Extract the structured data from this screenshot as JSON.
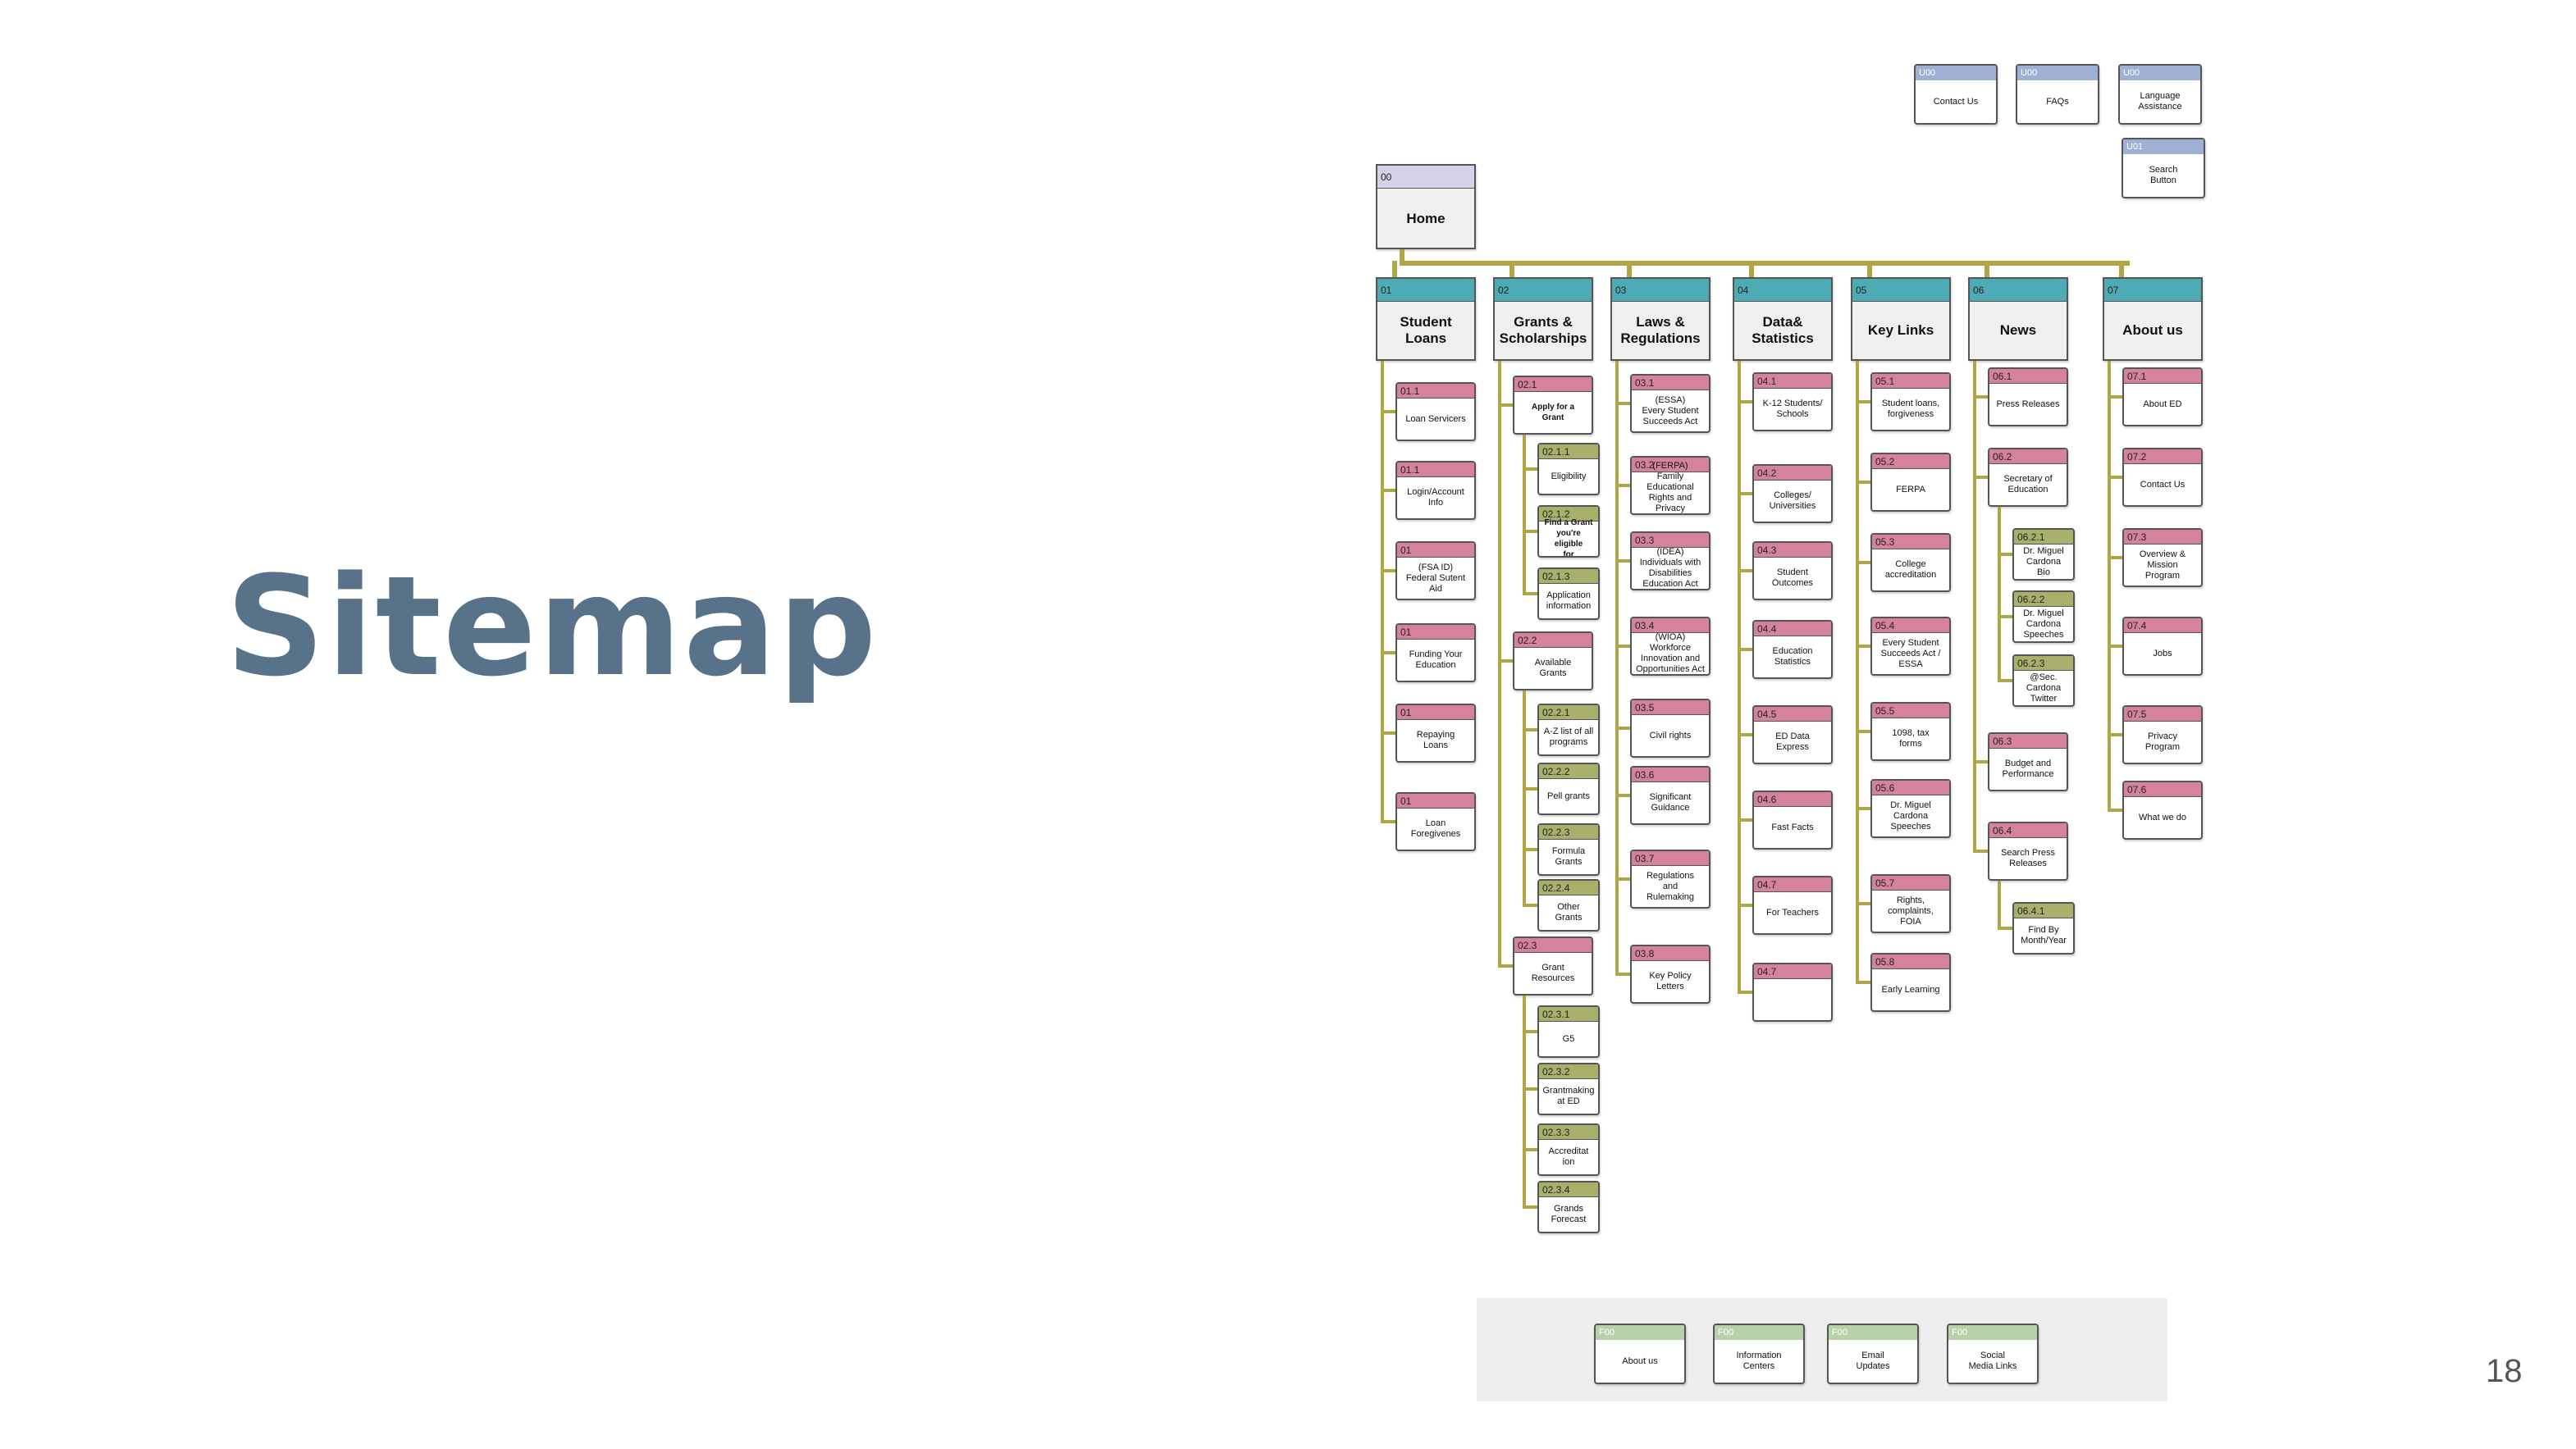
{
  "slide": {
    "title": "Sitemap",
    "page_number": "18"
  },
  "colors": {
    "home": "#d6d1e8",
    "main": "#4eaab5",
    "level2": "#d5839a",
    "level3": "#a8b06b",
    "utility": "#9fb0d4",
    "footer": "#b7d2a8",
    "connector": "#b1a646",
    "title": "#587289"
  },
  "utility_nav": [
    {
      "code": "U00",
      "label": "Contact Us"
    },
    {
      "code": "U00",
      "label": "FAQs"
    },
    {
      "code": "U00",
      "label": "Language\nAssistance"
    },
    {
      "code": "U01",
      "label": "Search\nButton"
    }
  ],
  "home": {
    "code": "00",
    "label": "Home"
  },
  "sections": [
    {
      "code": "01",
      "label": "Student\nLoans",
      "children": [
        {
          "code": "01.1",
          "label": "Loan Servicers",
          "children": []
        },
        {
          "code": "01.1",
          "label": "Login/Account\nInfo",
          "children": []
        },
        {
          "code": "01",
          "label": "(FSA ID)\nFederal Sutent\nAid",
          "children": []
        },
        {
          "code": "01",
          "label": "Funding Your\nEducation",
          "children": []
        },
        {
          "code": "01",
          "label": "Repaying\nLoans",
          "children": []
        },
        {
          "code": "01",
          "label": "Loan\nForegivenes",
          "children": []
        }
      ]
    },
    {
      "code": "02",
      "label": "Grants &\nScholarships",
      "children": [
        {
          "code": "02.1",
          "label": "Apply for a\nGrant",
          "bold": true,
          "children": [
            {
              "code": "02.1.1",
              "label": "Eligibility"
            },
            {
              "code": "02.1.2",
              "label": "Find a Grant\nyou're eligible\nfor",
              "bold": true
            },
            {
              "code": "02.1.3",
              "label": "Application\ninformation"
            }
          ]
        },
        {
          "code": "02.2",
          "label": "Available\nGrants",
          "children": [
            {
              "code": "02.2.1",
              "label": "A-Z list of all\nprograms"
            },
            {
              "code": "02.2.2",
              "label": "Pell grants"
            },
            {
              "code": "02.2.3",
              "label": "Formula\nGrants"
            },
            {
              "code": "02.2.4",
              "label": "Other\nGrants"
            }
          ]
        },
        {
          "code": "02.3",
          "label": "Grant\nResources",
          "children": [
            {
              "code": "02.3.1",
              "label": "G5"
            },
            {
              "code": "02.3.2",
              "label": "Grantmaking\nat ED"
            },
            {
              "code": "02.3.3",
              "label": "Accreditat\nion"
            },
            {
              "code": "02.3.4",
              "label": "Grands\nForecast"
            }
          ]
        }
      ]
    },
    {
      "code": "03",
      "label": "Laws &\nRegulations",
      "children": [
        {
          "code": "03.1",
          "label": "(ESSA)\nEvery Student\nSucceeds Act",
          "children": []
        },
        {
          "code": "03.2",
          "label": "(FERPA)\nFamily Educational\nRights and Privacy\nAct)",
          "children": []
        },
        {
          "code": "03.3",
          "label": "(IDEA)\nIndividuals with\nDisabilities\nEducation Act",
          "children": []
        },
        {
          "code": "03.4",
          "label": "(WIOA) Workforce\nInnovation and\nOpportunities Act",
          "children": []
        },
        {
          "code": "03.5",
          "label": "Civil rights",
          "children": []
        },
        {
          "code": "03.6",
          "label": "Significant\nGuidance",
          "children": []
        },
        {
          "code": "03.7",
          "label": "Regulations\nand\nRulemaking",
          "children": []
        },
        {
          "code": "03.8",
          "label": "Key Policy\nLetters",
          "children": []
        }
      ]
    },
    {
      "code": "04",
      "label": "Data&\nStatistics",
      "children": [
        {
          "code": "04.1",
          "label": "K-12 Students/\nSchools",
          "children": []
        },
        {
          "code": "04.2",
          "label": "Colleges/\nUniversities",
          "children": []
        },
        {
          "code": "04.3",
          "label": "Student\nOutcomes",
          "children": []
        },
        {
          "code": "04.4",
          "label": "Education\nStatistics",
          "children": []
        },
        {
          "code": "04.5",
          "label": "ED Data\nExpress",
          "children": []
        },
        {
          "code": "04.6",
          "label": "Fast Facts",
          "children": []
        },
        {
          "code": "04.7",
          "label": "For Teachers",
          "children": []
        },
        {
          "code": "04.7",
          "label": "",
          "children": []
        }
      ]
    },
    {
      "code": "05",
      "label": "Key Links",
      "children": [
        {
          "code": "05.1",
          "label": "Student loans,\nforgiveness",
          "children": []
        },
        {
          "code": "05.2",
          "label": "FERPA",
          "children": []
        },
        {
          "code": "05.3",
          "label": "College\naccreditation",
          "children": []
        },
        {
          "code": "05.4",
          "label": "Every Student\nSucceeds Act /\nESSA",
          "children": []
        },
        {
          "code": "05.5",
          "label": "1098, tax\nforms",
          "children": []
        },
        {
          "code": "05.6",
          "label": "Dr. Miguel\nCardona\nSpeeches",
          "children": []
        },
        {
          "code": "05.7",
          "label": "Rights,\ncomplaints,\nFOIA",
          "children": []
        },
        {
          "code": "05.8",
          "label": "Early Learning",
          "children": []
        }
      ]
    },
    {
      "code": "06",
      "label": "News",
      "children": [
        {
          "code": "06.1",
          "label": "Press Releases",
          "children": []
        },
        {
          "code": "06.2",
          "label": "Secretary of\nEducation",
          "children": [
            {
              "code": "06.2.1",
              "label": "Dr. Miguel\nCardona\nBio"
            },
            {
              "code": "06.2.2",
              "label": "Dr. Miguel\nCardona\nSpeeches"
            },
            {
              "code": "06.2.3",
              "label": "@Sec. Cardona\nTwitter"
            }
          ]
        },
        {
          "code": "06.3",
          "label": "Budget and\nPerformance",
          "children": []
        },
        {
          "code": "06.4",
          "label": "Search Press\nReleases",
          "children": [
            {
              "code": "06.4.1",
              "label": "Find By\nMonth/Year"
            }
          ]
        }
      ]
    },
    {
      "code": "07",
      "label": "About us",
      "children": [
        {
          "code": "07.1",
          "label": "About ED",
          "children": []
        },
        {
          "code": "07.2",
          "label": "Contact Us",
          "children": []
        },
        {
          "code": "07.3",
          "label": "Overview &\nMission\nProgram",
          "children": []
        },
        {
          "code": "07.4",
          "label": "Jobs",
          "children": []
        },
        {
          "code": "07.5",
          "label": "Privacy\nProgram",
          "children": []
        },
        {
          "code": "07.6",
          "label": "What we do",
          "children": []
        }
      ]
    }
  ],
  "footer_nav": [
    {
      "code": "F00",
      "label": "About us"
    },
    {
      "code": "F00",
      "label": "Information\nCenters"
    },
    {
      "code": "F00",
      "label": "Email\nUpdates"
    },
    {
      "code": "F00",
      "label": "Social\nMedia Links"
    }
  ]
}
